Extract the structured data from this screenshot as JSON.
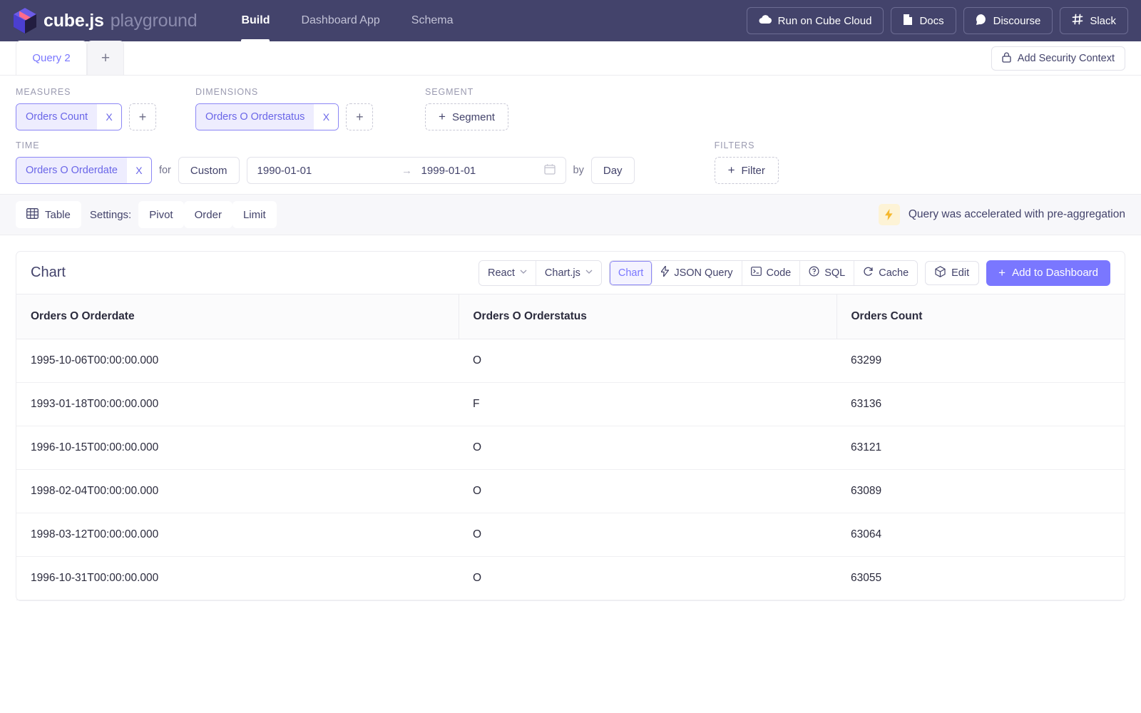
{
  "header": {
    "brand_name": "cube.js",
    "brand_suffix": "playground",
    "logo_icon": "cube-logo-icon",
    "nav_tabs": [
      {
        "label": "Build",
        "active": true
      },
      {
        "label": "Dashboard App",
        "active": false
      },
      {
        "label": "Schema",
        "active": false
      }
    ],
    "actions": [
      {
        "label": "Run on Cube Cloud",
        "icon": "cloud-icon"
      },
      {
        "label": "Docs",
        "icon": "document-icon"
      },
      {
        "label": "Discourse",
        "icon": "discourse-icon"
      },
      {
        "label": "Slack",
        "icon": "slack-icon"
      }
    ]
  },
  "tabbar": {
    "query_tab": "Query 2",
    "add_tab": "+",
    "security_context": "Add Security Context",
    "lock_icon": "lock-icon"
  },
  "builder": {
    "measures": {
      "label": "MEASURES",
      "pill": "Orders Count",
      "close": "X",
      "add": "+"
    },
    "dimensions": {
      "label": "DIMENSIONS",
      "pill": "Orders O Orderstatus",
      "close": "X",
      "add": "+"
    },
    "segment": {
      "label": "SEGMENT",
      "button": "Segment",
      "plus": "+"
    },
    "time": {
      "label": "TIME",
      "pill": "Orders O Orderdate",
      "close": "X",
      "for_word": "for",
      "range_mode": "Custom",
      "date_from": "1990-01-01",
      "date_to": "1999-01-01",
      "arrow": "→",
      "calendar_icon": "calendar-icon",
      "by_word": "by",
      "granularity": "Day"
    },
    "filters": {
      "label": "FILTERS",
      "button": "Filter",
      "plus": "+"
    }
  },
  "settings_bar": {
    "view_type": "Table",
    "table_icon": "table-grid-icon",
    "settings_word": "Settings:",
    "options": [
      "Pivot",
      "Order",
      "Limit"
    ],
    "acceleration_notice": "Query was accelerated with pre-aggregation",
    "bolt_icon": "lightning-bolt-icon"
  },
  "panel": {
    "title": "Chart",
    "framework": "React",
    "library": "Chart.js",
    "caret": "⌄",
    "views": [
      {
        "label": "Chart",
        "icon": "",
        "selected": true
      },
      {
        "label": "JSON Query",
        "icon": "lightning-bolt-icon",
        "selected": false
      },
      {
        "label": "Code",
        "icon": "terminal-icon",
        "selected": false
      },
      {
        "label": "SQL",
        "icon": "question-circle-icon",
        "selected": false
      },
      {
        "label": "Cache",
        "icon": "refresh-icon",
        "selected": false
      }
    ],
    "edit_label": "Edit",
    "edit_icon": "cube-icon",
    "add_dashboard_label": "Add to Dashboard",
    "add_dashboard_plus": "+"
  },
  "table": {
    "columns": [
      "Orders O Orderdate",
      "Orders O Orderstatus",
      "Orders Count"
    ],
    "rows": [
      [
        "1995-10-06T00:00:00.000",
        "O",
        "63299"
      ],
      [
        "1993-01-18T00:00:00.000",
        "F",
        "63136"
      ],
      [
        "1996-10-15T00:00:00.000",
        "O",
        "63121"
      ],
      [
        "1998-02-04T00:00:00.000",
        "O",
        "63089"
      ],
      [
        "1998-03-12T00:00:00.000",
        "O",
        "63064"
      ],
      [
        "1996-10-31T00:00:00.000",
        "O",
        "63055"
      ]
    ]
  },
  "colors": {
    "nav_bg": "#43436b",
    "accent": "#7a77ff",
    "accent_light": "#eeedfe",
    "text_dark": "#43436b",
    "muted": "#9a9ab0"
  }
}
